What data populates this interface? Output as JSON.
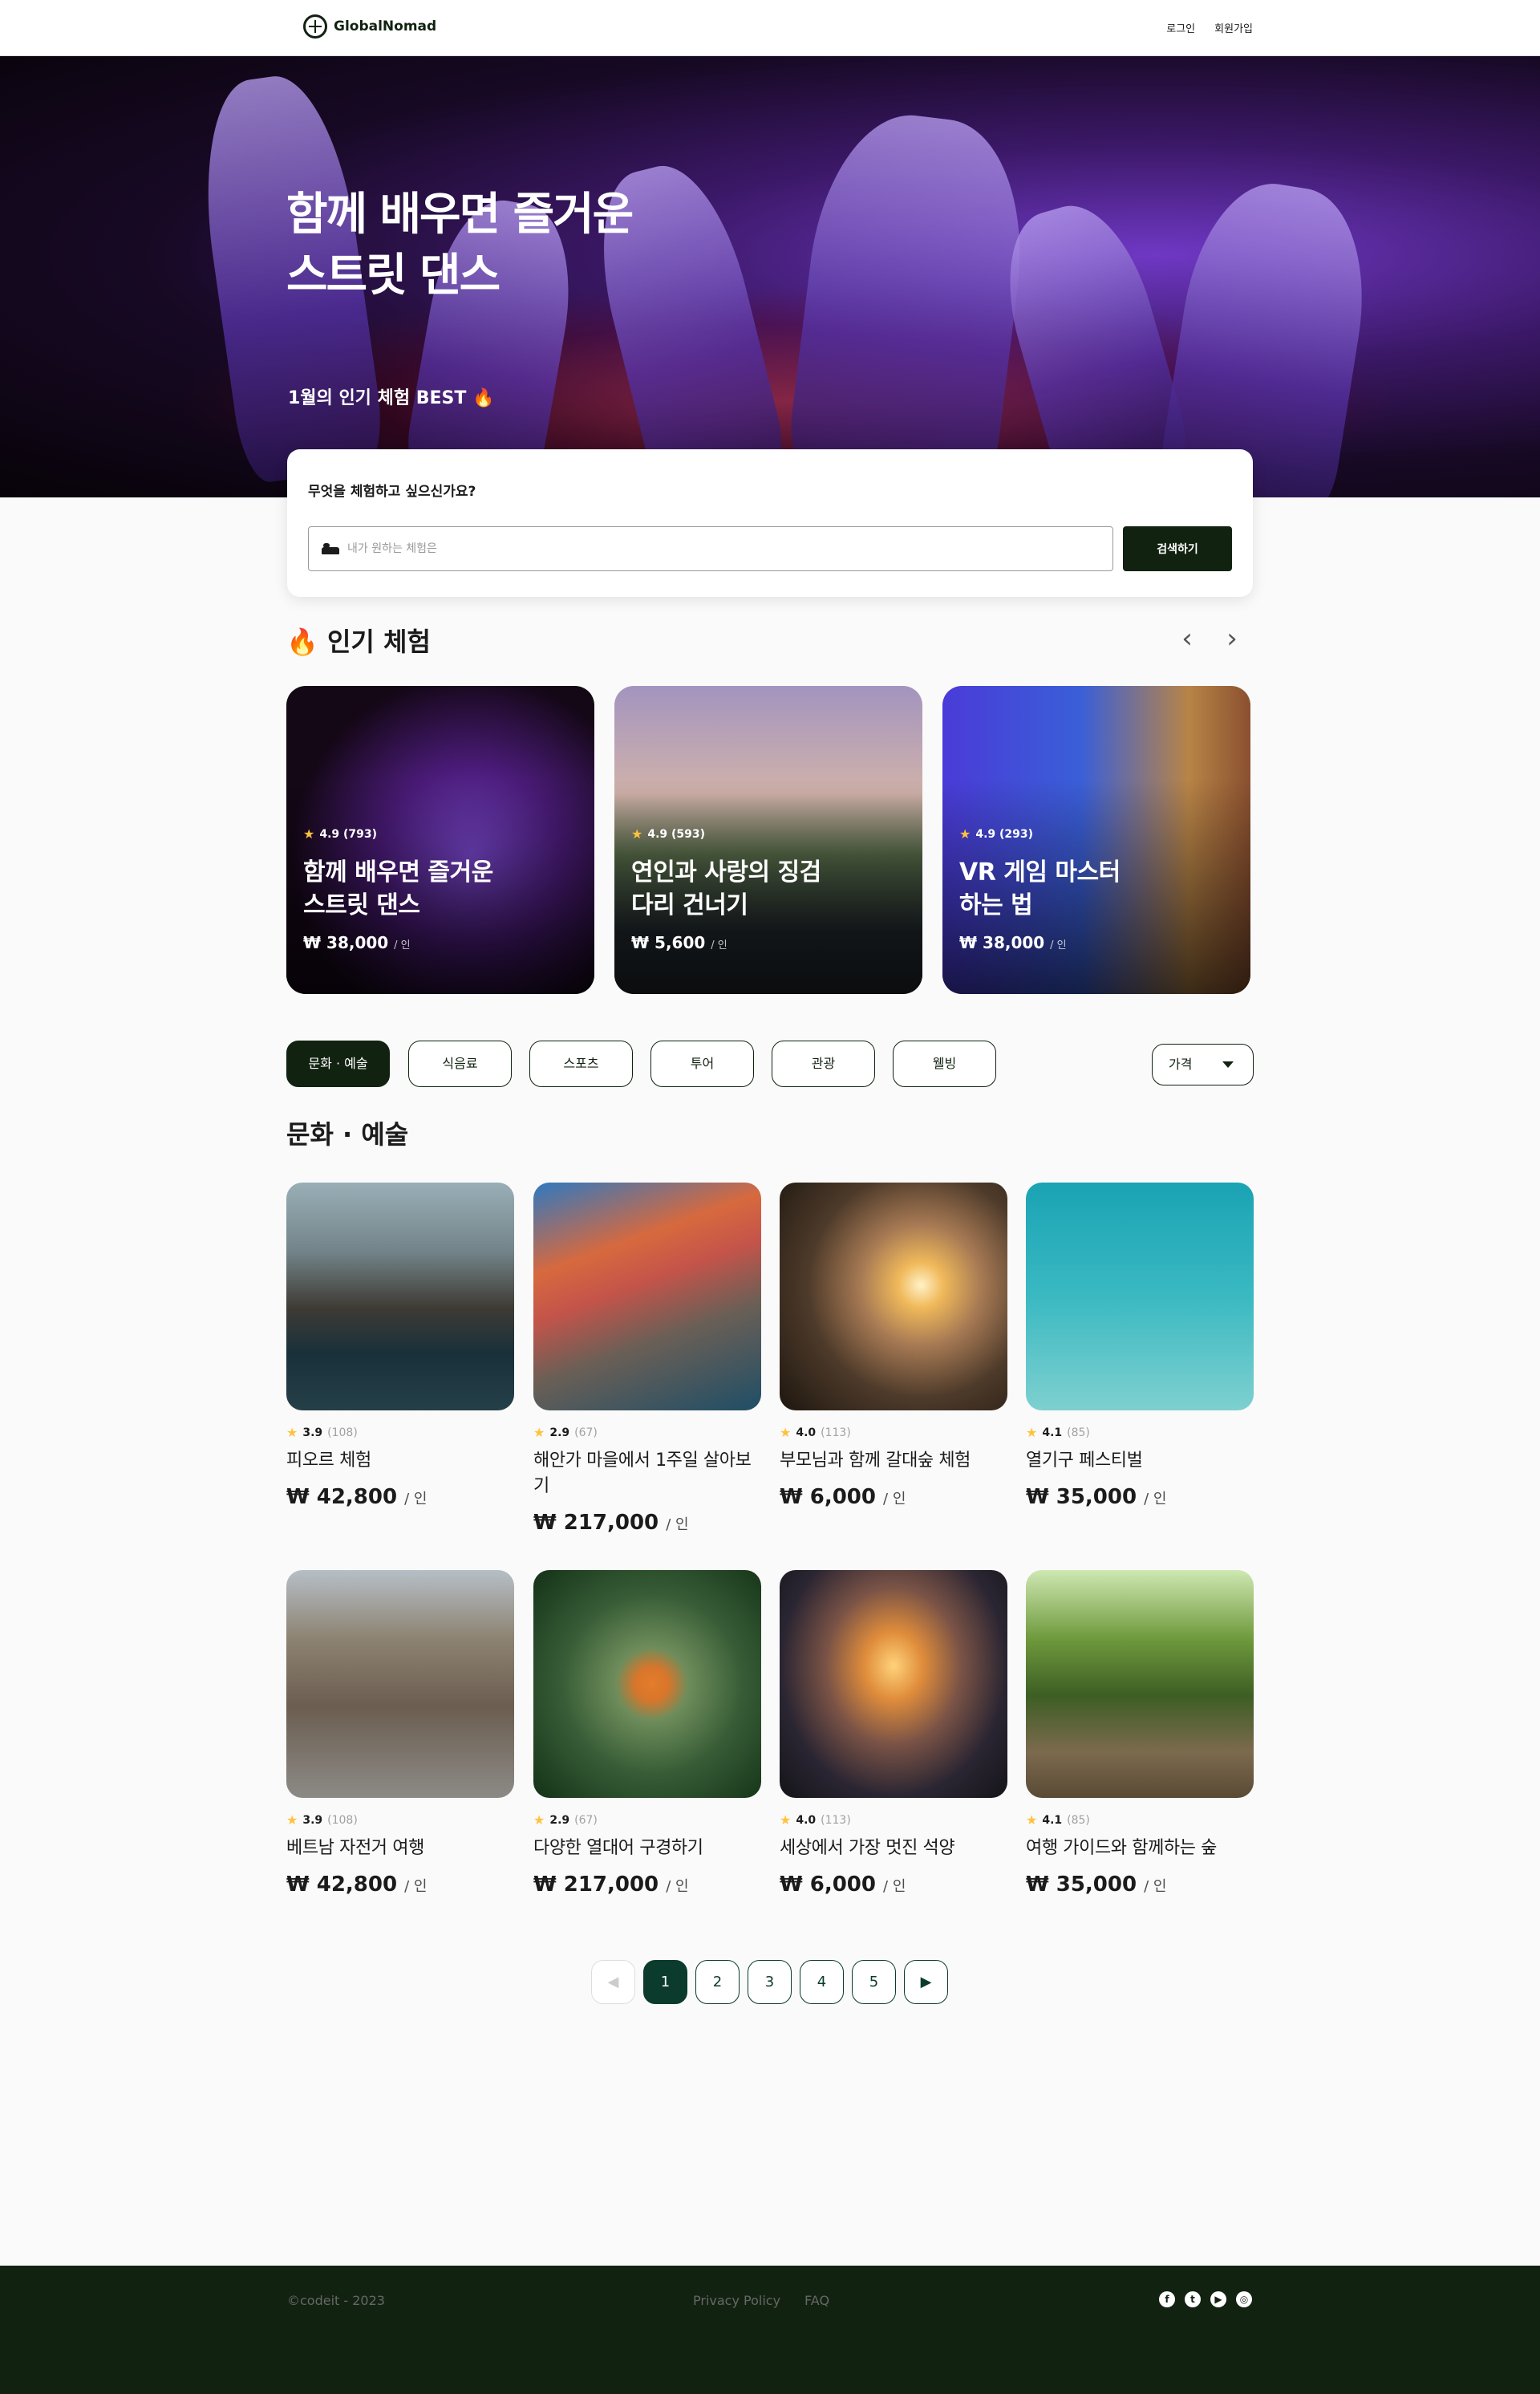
{
  "nav": {
    "logo": "GlobalNomad",
    "login": "로그인",
    "signup": "회원가입"
  },
  "hero": {
    "title": "함께 배우면 즐거운\n스트릿 댄스",
    "subtitle": "1월의 인기 체험 BEST 🔥"
  },
  "search": {
    "label": "무엇을 체험하고 싶으신가요?",
    "placeholder": "내가 원하는 체험은",
    "button": "검색하기"
  },
  "popular": {
    "title": "🔥 인기 체험",
    "prev_icon": "chevron-left",
    "next_icon": "chevron-right",
    "items": [
      {
        "rating": "4.9 (793)",
        "title": "함께 배우면 즐거운\n스트릿 댄스",
        "price": "₩ 38,000",
        "unit": "/ 인"
      },
      {
        "rating": "4.9 (593)",
        "title": "연인과 사랑의 징검\n다리 건너기",
        "price": "₩ 5,600",
        "unit": "/ 인"
      },
      {
        "rating": "4.9 (293)",
        "title": "VR 게임 마스터\n하는 법",
        "price": "₩ 38,000",
        "unit": "/ 인"
      }
    ]
  },
  "categories": [
    "문화 · 예술",
    "식음료",
    "스포츠",
    "투어",
    "관광",
    "웰빙"
  ],
  "active_category": "문화 · 예술",
  "price_filter": "가격",
  "section_title": "문화 · 예술",
  "activities": [
    {
      "rating": "3.9",
      "count": "(108)",
      "title": "피오르 체험",
      "price": "₩ 42,800",
      "unit": "/ 인"
    },
    {
      "rating": "2.9",
      "count": "(67)",
      "title": "해안가 마을에서 1주일 살아보기",
      "price": "₩ 217,000",
      "unit": "/ 인"
    },
    {
      "rating": "4.0",
      "count": "(113)",
      "title": "부모님과 함께 갈대숲 체험",
      "price": "₩ 6,000",
      "unit": "/ 인"
    },
    {
      "rating": "4.1",
      "count": "(85)",
      "title": "열기구 페스티벌",
      "price": "₩ 35,000",
      "unit": "/ 인"
    },
    {
      "rating": "3.9",
      "count": "(108)",
      "title": "베트남 자전거 여행",
      "price": "₩ 42,800",
      "unit": "/ 인"
    },
    {
      "rating": "2.9",
      "count": "(67)",
      "title": "다양한 열대어 구경하기",
      "price": "₩ 217,000",
      "unit": "/ 인"
    },
    {
      "rating": "4.0",
      "count": "(113)",
      "title": "세상에서 가장 멋진 석양",
      "price": "₩ 6,000",
      "unit": "/ 인"
    },
    {
      "rating": "4.1",
      "count": "(85)",
      "title": "여행 가이드와 함께하는 숲",
      "price": "₩ 35,000",
      "unit": "/ 인"
    }
  ],
  "pagination": {
    "pages": [
      "1",
      "2",
      "3",
      "4",
      "5"
    ],
    "current": "1",
    "prev": "◀",
    "next": "▶"
  },
  "footer": {
    "copyright": "©codeit - 2023",
    "privacy": "Privacy Policy",
    "faq": "FAQ",
    "socials": [
      "facebook",
      "twitter",
      "youtube",
      "instagram"
    ]
  },
  "colors": {
    "brand": "#112211",
    "accent": "#0b3b2d",
    "star": "#ffc23d"
  }
}
